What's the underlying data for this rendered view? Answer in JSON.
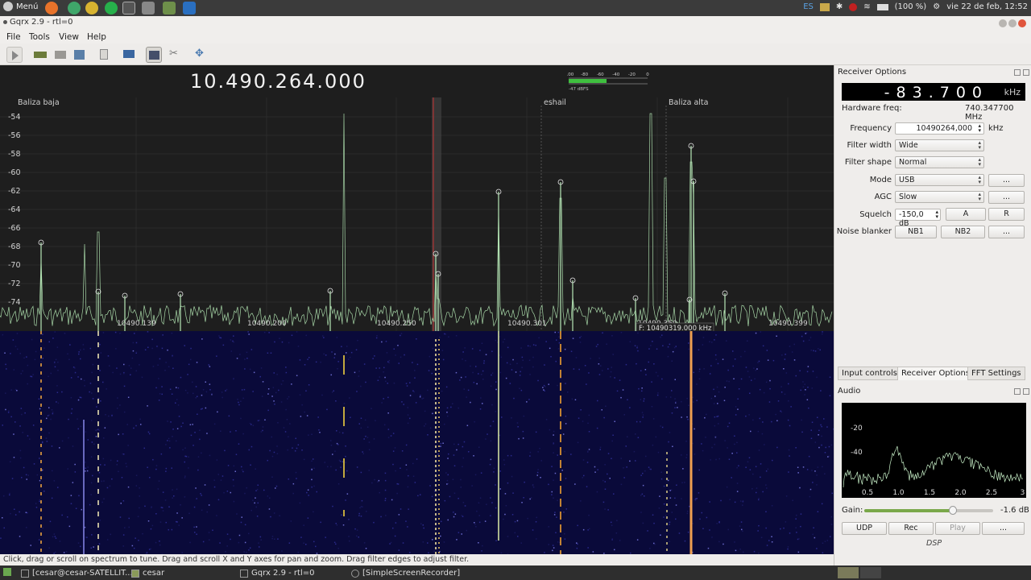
{
  "desktop": {
    "menu_label": "Menú",
    "tray": {
      "lang": "ES",
      "battery": "(100 %)",
      "clock": "vie 22 de feb, 12:52"
    }
  },
  "window": {
    "title": "Gqrx 2.9 - rtl=0",
    "menus": [
      "File",
      "Tools",
      "View",
      "Help"
    ]
  },
  "main": {
    "frequency_display": "10.490.264.000",
    "meter": {
      "ticks": [
        "-100",
        "-80",
        "-60",
        "-40",
        "-20",
        "0"
      ],
      "level_text": "-47 dBFS",
      "level_fraction": 0.48
    },
    "bookmarks": [
      "Baliza baja",
      "eshail",
      "Baliza alta"
    ],
    "y_ticks": [
      "-54",
      "-56",
      "-58",
      "-60",
      "-62",
      "-64",
      "-66",
      "-68",
      "-70",
      "-72",
      "-74"
    ],
    "x_ticks": [
      "10490.139",
      "10490.200",
      "10490.250",
      "10490.301",
      "10490.350",
      "10490.399"
    ],
    "cursor_readout": "F: 10490319.000 kHz"
  },
  "status_bar": "Click, drag or scroll on spectrum to tune. Drag and scroll X and Y axes for pan and zoom. Drag filter edges to adjust filter.",
  "receiver_options": {
    "title": "Receiver Options",
    "offset_digits": "-83.700",
    "offset_unit": "kHz",
    "hw_freq_label": "Hardware freq:",
    "hw_freq_value": "740.347700 MHz",
    "frequency_label": "Frequency",
    "frequency_value": "10490264,000",
    "frequency_unit": "kHz",
    "filter_width_label": "Filter width",
    "filter_width_value": "Wide",
    "filter_shape_label": "Filter shape",
    "filter_shape_value": "Normal",
    "mode_label": "Mode",
    "mode_value": "USB",
    "agc_label": "AGC",
    "agc_value": "Slow",
    "squelch_label": "Squelch",
    "squelch_value": "-150,0 dB",
    "squelch_a": "A",
    "squelch_r": "R",
    "noise_blanker_label": "Noise blanker",
    "nb1": "NB1",
    "nb2": "NB2",
    "more": "..."
  },
  "tabs": [
    "Input controls",
    "Receiver Options",
    "FFT Settings"
  ],
  "audio": {
    "title": "Audio",
    "y_ticks": [
      "-20",
      "-40"
    ],
    "x_ticks": [
      "0.5",
      "1.0",
      "1.5",
      "2.0",
      "2.5",
      "3"
    ],
    "gain_label": "Gain:",
    "gain_value": "-1.6 dB",
    "gain_fraction": 0.69,
    "buttons": [
      "UDP",
      "Rec",
      "Play",
      "..."
    ],
    "dsp_label": "DSP"
  },
  "taskbar": {
    "items": [
      "[cesar@cesar-SATELLIT...",
      "cesar",
      "Gqrx 2.9 - rtl=0",
      "[SimpleScreenRecorder]"
    ]
  },
  "colors": {
    "spectrum_bg": "#1e1e1e",
    "trace": "#a8d8a8",
    "waterfall_bg": "#0a0a3a",
    "filter_marker": "#c83232"
  }
}
